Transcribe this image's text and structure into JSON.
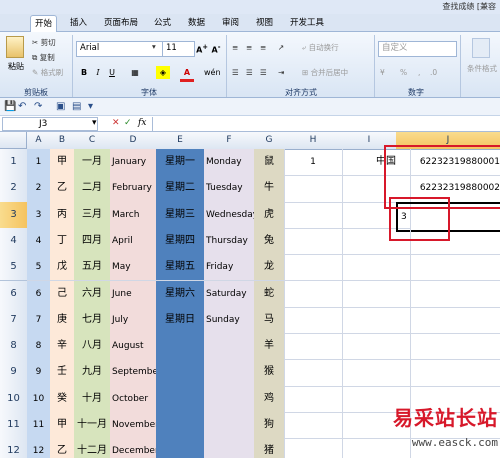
{
  "titlebar": {
    "title": "查找成绩 [兼容"
  },
  "tabs": [
    "开始",
    "插入",
    "页面布局",
    "公式",
    "数据",
    "审阅",
    "视图",
    "开发工具"
  ],
  "ribbon": {
    "paste": "粘贴",
    "cut": "剪切",
    "copy": "复制",
    "format_painter": "格式刷",
    "font_name": "Arial",
    "font_size": "11",
    "wrap_text": "自动换行",
    "merge_center": "合并后居中",
    "number_format": "自定义",
    "conditional": "条件格式",
    "groups": {
      "clipboard": "剪贴板",
      "font": "字体",
      "alignment": "对齐方式",
      "number": "数字"
    }
  },
  "formula_bar": {
    "name_box": "J3",
    "fx": "fx",
    "content": ""
  },
  "columns": [
    "A",
    "B",
    "C",
    "D",
    "E",
    "F",
    "G",
    "H",
    "I",
    "J"
  ],
  "rows": [
    "1",
    "2",
    "3",
    "4",
    "5",
    "6",
    "7",
    "8",
    "9",
    "10",
    "11",
    "12"
  ],
  "cells": {
    "A": [
      "1",
      "2",
      "3",
      "4",
      "5",
      "6",
      "7",
      "8",
      "9",
      "10",
      "11",
      "12"
    ],
    "B": [
      "甲",
      "乙",
      "丙",
      "丁",
      "戊",
      "己",
      "庚",
      "辛",
      "壬",
      "癸",
      "甲",
      "乙"
    ],
    "C": [
      "一月",
      "二月",
      "三月",
      "四月",
      "五月",
      "六月",
      "七月",
      "八月",
      "九月",
      "十月",
      "十一月",
      "十二月"
    ],
    "D": [
      "January",
      "February",
      "March",
      "April",
      "May",
      "June",
      "July",
      "August",
      "September",
      "October",
      "November",
      "December"
    ],
    "E": [
      "星期一",
      "星期二",
      "星期三",
      "星期四",
      "星期五",
      "星期六",
      "星期日",
      "",
      "",
      "",
      "",
      ""
    ],
    "F": [
      "Monday",
      "Tuesday",
      "Wednesday",
      "Thursday",
      "Friday",
      "Saturday",
      "Sunday",
      "",
      "",
      "",
      "",
      ""
    ],
    "G": [
      "鼠",
      "牛",
      "虎",
      "兔",
      "龙",
      "蛇",
      "马",
      "羊",
      "猴",
      "鸡",
      "狗",
      "猪"
    ],
    "H1": "1",
    "I1": "中国",
    "J1": "62232319880001",
    "J2": "62232319880002",
    "J3": "3"
  },
  "colors": {
    "colA": "#c6d9f1",
    "colB": "#fde9d9",
    "colC": "#d7e4bd",
    "colD": "#f2dcdb",
    "colE": "#4f81bd",
    "colF": "#e6e0ec",
    "colG": "#ddd9c3",
    "highlight": "#d7182a"
  },
  "watermark": {
    "line1": "易采站长站",
    "line2": "www.easck.com"
  }
}
